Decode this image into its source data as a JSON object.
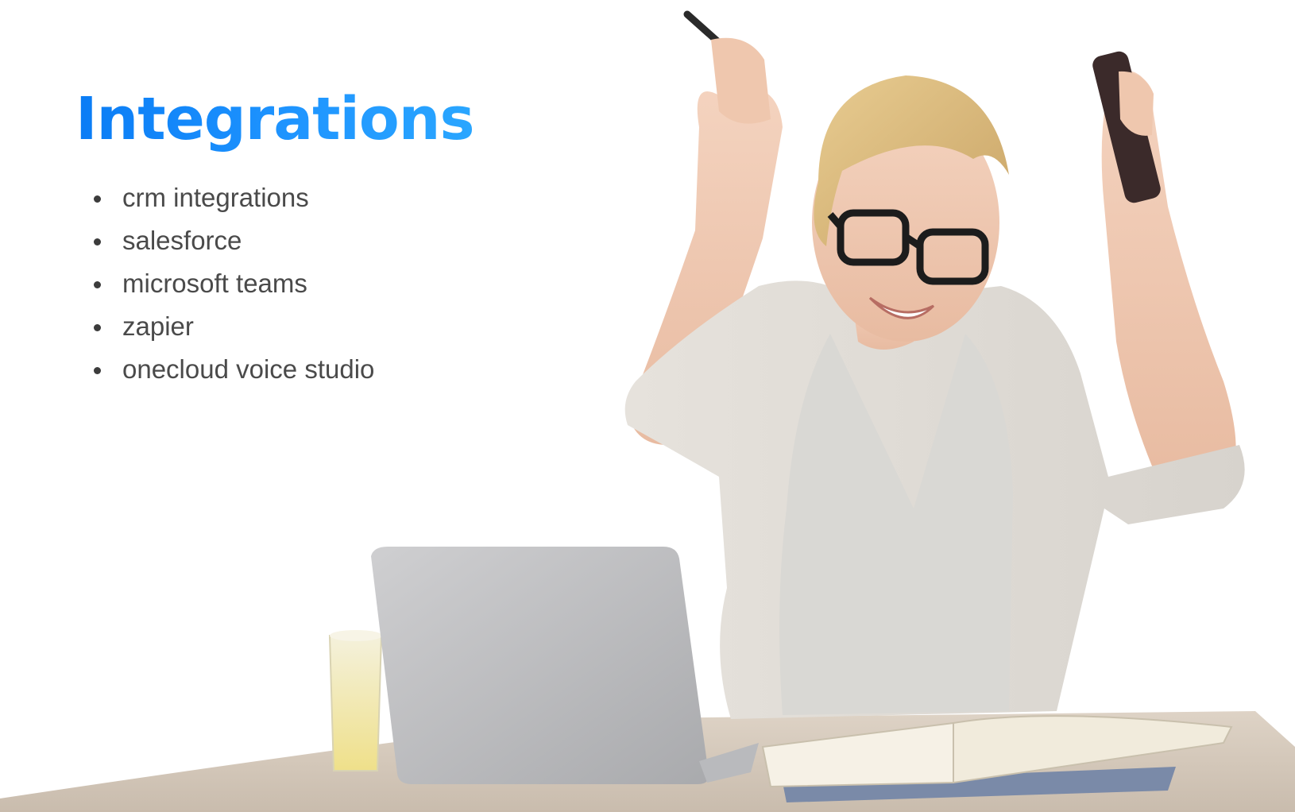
{
  "heading": {
    "title": "Integrations",
    "color": "#1a8cff"
  },
  "integrations": {
    "items": [
      {
        "label": "crm integrations"
      },
      {
        "label": "salesforce"
      },
      {
        "label": "microsoft teams"
      },
      {
        "label": "zapier"
      },
      {
        "label": "onecloud voice studio"
      }
    ]
  },
  "photo": {
    "subject": "woman-celebrating-at-laptop"
  }
}
